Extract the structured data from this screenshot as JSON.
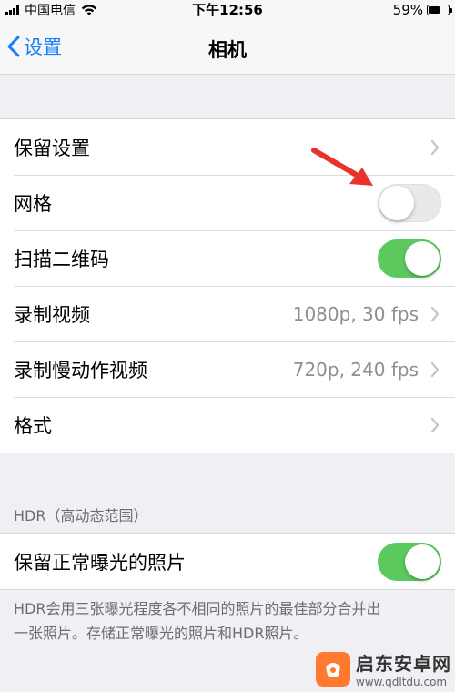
{
  "status_bar": {
    "carrier": "中国电信",
    "time": "下午12:56",
    "battery": "59%",
    "battery_level": 0.59
  },
  "nav": {
    "back_label": "设置",
    "title": "相机"
  },
  "group1": {
    "rows": [
      {
        "label": "保留设置",
        "value": "",
        "control": "chevron"
      },
      {
        "label": "网格",
        "value": "",
        "control": "toggle",
        "on": false
      },
      {
        "label": "扫描二维码",
        "value": "",
        "control": "toggle",
        "on": true
      },
      {
        "label": "录制视频",
        "value": "1080p, 30 fps",
        "control": "chevron"
      },
      {
        "label": "录制慢动作视频",
        "value": "720p, 240 fps",
        "control": "chevron"
      },
      {
        "label": "格式",
        "value": "",
        "control": "chevron"
      }
    ]
  },
  "hdr": {
    "header": "HDR（高动态范围）",
    "row_label": "保留正常曝光的照片",
    "row_on": true,
    "footer_line1": "HDR会用三张曝光程度各不相同的照片的最佳部分合并出",
    "footer_line2": "一张照片。存储正常曝光的照片和HDR照片。"
  },
  "watermark": {
    "name": "启东安卓网",
    "url": "www.qdltdu.com"
  },
  "colors": {
    "accent": "#157efb",
    "toggle_on": "#5bc95e",
    "arrow": "#e8322f",
    "background": "#efeff4"
  }
}
